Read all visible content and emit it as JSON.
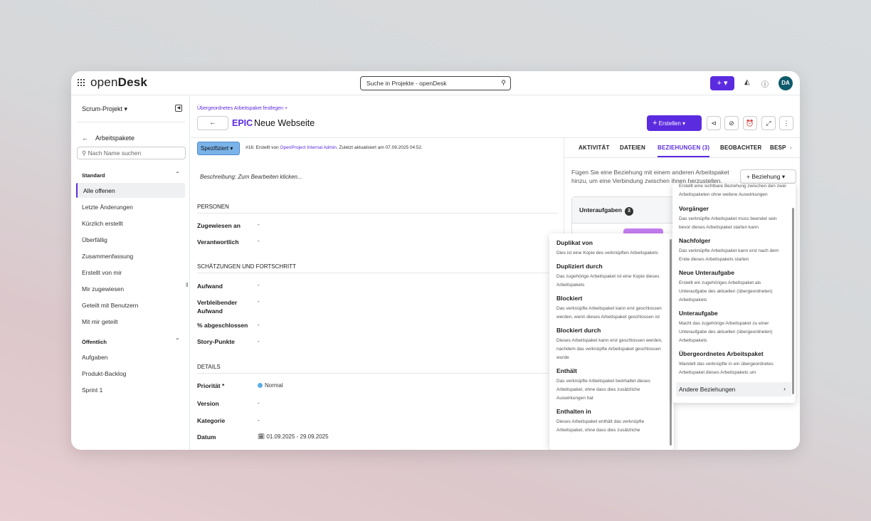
{
  "topbar": {
    "logo_light": "open",
    "logo_bold": "Desk",
    "search_placeholder": "Suche in Projekte - openDesk",
    "add_label": "+ ▾",
    "avatar_initials": "DA"
  },
  "sidebar": {
    "project": "Scrum-Projekt",
    "back_label": "Arbeitspakete",
    "search_placeholder": "Nach Name suchen",
    "standard_label": "Standard",
    "standard_items": [
      "Alle offenen",
      "Letzte Änderungen",
      "Kürzlich erstellt",
      "Überfällig",
      "Zusammenfassung",
      "Erstellt von mir",
      "Mir zugewiesen",
      "Geteilt mit Benutzern",
      "Mit mir geteilt"
    ],
    "public_label": "Öffentlich",
    "public_items": [
      "Aufgaben",
      "Produkt-Backlog",
      "Sprint 1"
    ]
  },
  "header": {
    "parent_link": "Übergeordnetes Arbeitspaket festlegen +",
    "type": "EPIC",
    "title": "Neue Webseite",
    "create_label": "Erstellen"
  },
  "main": {
    "status": "Spezifiziert",
    "created_prefix": "#16: Erstellt von",
    "created_author": "OpenProject Internal Admin",
    "created_suffix": ". Zuletzt aktualisiert am 07.09.2025 04:52.",
    "description_placeholder": "Beschreibung: Zum Bearbeiten klicken...",
    "sections": {
      "people": "PERSONEN",
      "estimates": "SCHÄTZUNGEN UND FORTSCHRITT",
      "details": "DETAILS"
    },
    "fields": {
      "assignee_label": "Zugewiesen an",
      "assignee_value": "-",
      "responsible_label": "Verantwortlich",
      "responsible_value": "-",
      "work_label": "Aufwand",
      "work_value": "-",
      "remaining_label": "Verbleibender Aufwand",
      "remaining_value": "-",
      "done_label": "% abgeschlossen",
      "done_value": "-",
      "story_label": "Story-Punkte",
      "story_value": "-",
      "priority_label": "Priorität *",
      "priority_value": "Normal",
      "version_label": "Version",
      "version_value": "-",
      "category_label": "Kategorie",
      "category_value": "-",
      "date_label": "Datum",
      "date_value": "01.09.2025 - 29.09.2025"
    }
  },
  "panel": {
    "tabs": [
      "AKTIVITÄT",
      "DATEIEN",
      "BEZIEHUNGEN (3)",
      "BEOBACHTER",
      "BESP"
    ],
    "info": "Fügen Sie eine Beziehung mit einem anderen Arbeitspaket hinzu, um eine Verbindung zwischen ihnen herzustellen.",
    "relation_button": "+ Beziehung",
    "subtasks_label": "Unteraufgaben",
    "subtasks_count": "3"
  },
  "menu_left": [
    {
      "title": "Duplikat von",
      "desc": "Dies ist eine Kopie des verknüpften Arbeitspakets"
    },
    {
      "title": "Dupliziert durch",
      "desc": "Das zugehörige Arbeitspaket ist eine Kopie dieses Arbeitspakets"
    },
    {
      "title": "Blockiert",
      "desc": "Das verknüpfte Arbeitspaket kann erst geschlossen werden, wenn dieses Arbeitspaket geschlossen ist"
    },
    {
      "title": "Blockiert durch",
      "desc": "Dieses Arbeitspaket kann erst geschlossen werden, nachdem das verknüpfte Arbeitspaket geschlossen wurde"
    },
    {
      "title": "Enthält",
      "desc": "Das verknüpfte Arbeitspaket beinhaltet dieses Arbeitspaket, ohne dass dies zusätzliche Auswirkungen hat"
    },
    {
      "title": "Enthalten in",
      "desc": "Dieses Arbeitspaket enthält das verknüpfte Arbeitspaket, ohne dass dies zusätzliche"
    }
  ],
  "menu_right": {
    "top_desc": "Erstellt eine sichtbare Beziehung zwischen den zwei Arbeitspaketen ohne weitere Auswirkungen",
    "items": [
      {
        "title": "Vorgänger",
        "desc": "Das verknüpfte Arbeitspaket muss beendet sein bevor dieses Arbeitspaket starten kann"
      },
      {
        "title": "Nachfolger",
        "desc": "Das verknüpfte Arbeitspaket kann erst nach dem Ende dieses Arbeitspakets starten"
      },
      {
        "title": "Neue Unteraufgabe",
        "desc": "Erstellt ein zugehöriges Arbeitspaket als Unteraufgabe des aktuellen (übergeordneten) Arbeitspakets"
      },
      {
        "title": "Unteraufgabe",
        "desc": "Macht das zugehörige Arbeitspaket zu einer Unteraufgabe des aktuellen (übergeordneten) Arbeitspakets"
      },
      {
        "title": "Übergeordnetes Arbeitspaket",
        "desc": "Wandelt das verknüpfte in ein übergeordnetes Arbeitspaket dieses Arbeitspakets um"
      }
    ],
    "other_label": "Andere Beziehungen"
  }
}
